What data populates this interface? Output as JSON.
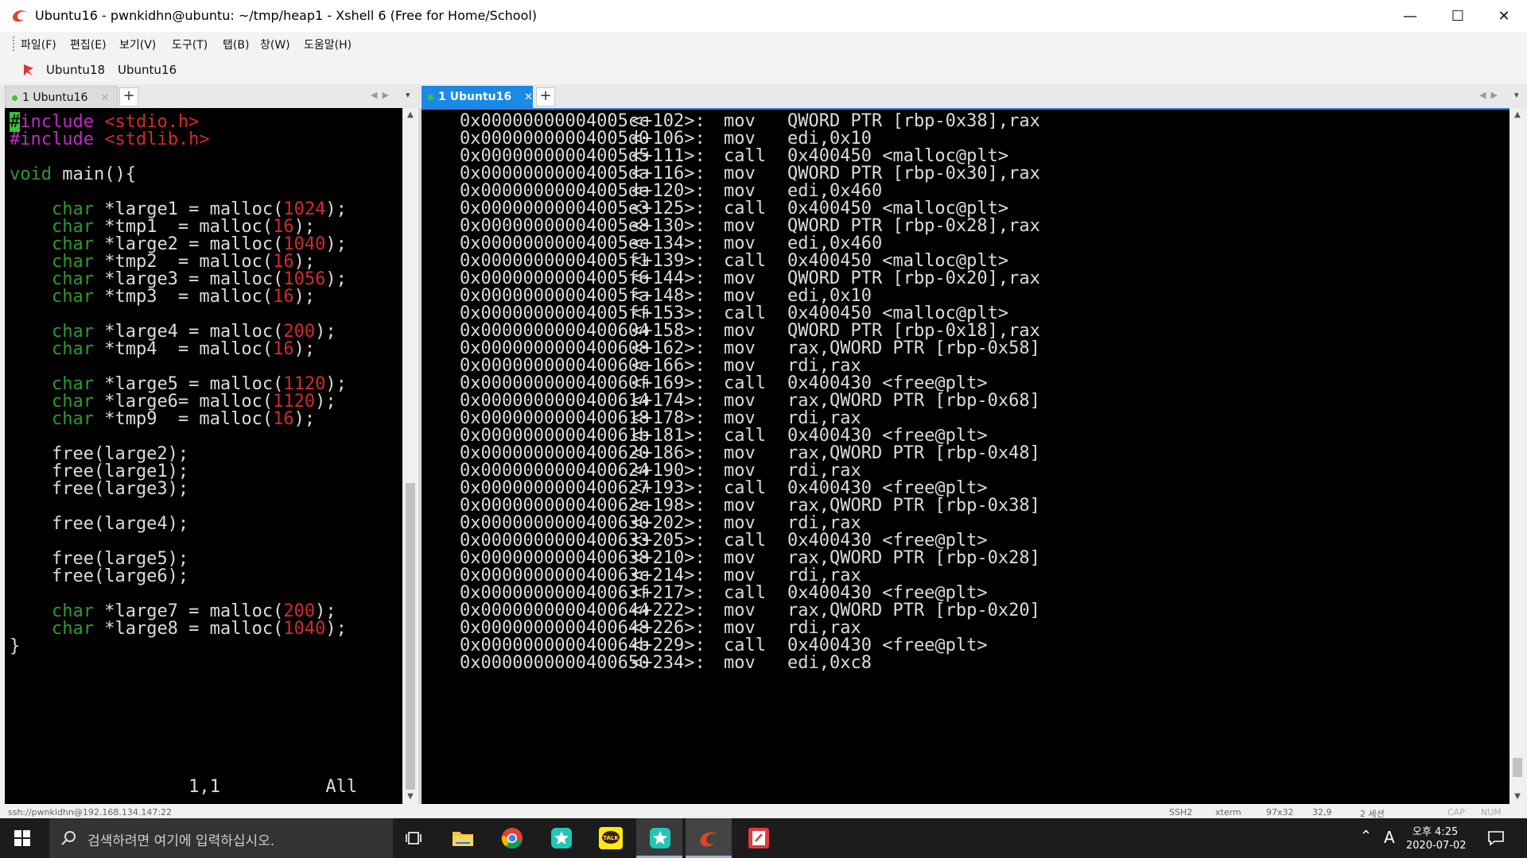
{
  "window": {
    "title": "Ubuntu16 - pwnkidhn@ubuntu: ~/tmp/heap1 - Xshell 6 (Free for Home/School)",
    "minimize": "—",
    "maximize": "☐",
    "close": "✕"
  },
  "menu": [
    "파일(F)",
    "편집(E)",
    "보기(V)",
    "도구(T)",
    "탭(B)",
    "창(W)",
    "도움말(H)"
  ],
  "sessions": [
    "Ubuntu18",
    "Ubuntu16"
  ],
  "left_tab": {
    "label": "1 Ubuntu16",
    "close": "✕",
    "add": "+"
  },
  "right_tab": {
    "label": "1 Ubuntu16",
    "close": "✕",
    "add": "+"
  },
  "tab_nav": {
    "prev": "◀",
    "next": "▶",
    "menu": "▾"
  },
  "editor": {
    "lines": [
      [
        {
          "t": "#",
          "c": "cursor"
        },
        {
          "t": "include ",
          "c": "pp"
        },
        {
          "t": "<stdio.h>",
          "c": "str"
        }
      ],
      [
        {
          "t": "#include ",
          "c": "pp"
        },
        {
          "t": "<stdlib.h>",
          "c": "str"
        }
      ],
      [],
      [
        {
          "t": "void",
          "c": "kw"
        },
        {
          "t": " main(){",
          "c": ""
        }
      ],
      [],
      [
        {
          "t": "    ",
          "c": ""
        },
        {
          "t": "char",
          "c": "kw"
        },
        {
          "t": " *large1 = malloc(",
          "c": ""
        },
        {
          "t": "1024",
          "c": "num"
        },
        {
          "t": ");",
          "c": ""
        }
      ],
      [
        {
          "t": "    ",
          "c": ""
        },
        {
          "t": "char",
          "c": "kw"
        },
        {
          "t": " *tmp1  = malloc(",
          "c": ""
        },
        {
          "t": "16",
          "c": "num"
        },
        {
          "t": ");",
          "c": ""
        }
      ],
      [
        {
          "t": "    ",
          "c": ""
        },
        {
          "t": "char",
          "c": "kw"
        },
        {
          "t": " *large2 = malloc(",
          "c": ""
        },
        {
          "t": "1040",
          "c": "num"
        },
        {
          "t": ");",
          "c": ""
        }
      ],
      [
        {
          "t": "    ",
          "c": ""
        },
        {
          "t": "char",
          "c": "kw"
        },
        {
          "t": " *tmp2  = malloc(",
          "c": ""
        },
        {
          "t": "16",
          "c": "num"
        },
        {
          "t": ");",
          "c": ""
        }
      ],
      [
        {
          "t": "    ",
          "c": ""
        },
        {
          "t": "char",
          "c": "kw"
        },
        {
          "t": " *large3 = malloc(",
          "c": ""
        },
        {
          "t": "1056",
          "c": "num"
        },
        {
          "t": ");",
          "c": ""
        }
      ],
      [
        {
          "t": "    ",
          "c": ""
        },
        {
          "t": "char",
          "c": "kw"
        },
        {
          "t": " *tmp3  = malloc(",
          "c": ""
        },
        {
          "t": "16",
          "c": "num"
        },
        {
          "t": ");",
          "c": ""
        }
      ],
      [],
      [
        {
          "t": "    ",
          "c": ""
        },
        {
          "t": "char",
          "c": "kw"
        },
        {
          "t": " *large4 = malloc(",
          "c": ""
        },
        {
          "t": "200",
          "c": "num"
        },
        {
          "t": ");",
          "c": ""
        }
      ],
      [
        {
          "t": "    ",
          "c": ""
        },
        {
          "t": "char",
          "c": "kw"
        },
        {
          "t": " *tmp4  = malloc(",
          "c": ""
        },
        {
          "t": "16",
          "c": "num"
        },
        {
          "t": ");",
          "c": ""
        }
      ],
      [],
      [
        {
          "t": "    ",
          "c": ""
        },
        {
          "t": "char",
          "c": "kw"
        },
        {
          "t": " *large5 = malloc(",
          "c": ""
        },
        {
          "t": "1120",
          "c": "num"
        },
        {
          "t": ");",
          "c": ""
        }
      ],
      [
        {
          "t": "    ",
          "c": ""
        },
        {
          "t": "char",
          "c": "kw"
        },
        {
          "t": " *large6= malloc(",
          "c": ""
        },
        {
          "t": "1120",
          "c": "num"
        },
        {
          "t": ");",
          "c": ""
        }
      ],
      [
        {
          "t": "    ",
          "c": ""
        },
        {
          "t": "char",
          "c": "kw"
        },
        {
          "t": " *tmp9  = malloc(",
          "c": ""
        },
        {
          "t": "16",
          "c": "num"
        },
        {
          "t": ");",
          "c": ""
        }
      ],
      [],
      [
        {
          "t": "    free(large2);",
          "c": ""
        }
      ],
      [
        {
          "t": "    free(large1);",
          "c": ""
        }
      ],
      [
        {
          "t": "    free(large3);",
          "c": ""
        }
      ],
      [],
      [
        {
          "t": "    free(large4);",
          "c": ""
        }
      ],
      [],
      [
        {
          "t": "    free(large5);",
          "c": ""
        }
      ],
      [
        {
          "t": "    free(large6);",
          "c": ""
        }
      ],
      [],
      [
        {
          "t": "    ",
          "c": ""
        },
        {
          "t": "char",
          "c": "kw"
        },
        {
          "t": " *large7 = malloc(",
          "c": ""
        },
        {
          "t": "200",
          "c": "num"
        },
        {
          "t": ");",
          "c": ""
        }
      ],
      [
        {
          "t": "    ",
          "c": ""
        },
        {
          "t": "char",
          "c": "kw"
        },
        {
          "t": " *large8 = malloc(",
          "c": ""
        },
        {
          "t": "1040",
          "c": "num"
        },
        {
          "t": ");",
          "c": ""
        }
      ],
      [
        {
          "t": "}",
          "c": ""
        }
      ]
    ],
    "status": "                 1,1          All"
  },
  "disasm": [
    [
      "0x00000000004005cc",
      "<+102>:",
      "mov",
      "QWORD PTR [rbp-0x38],rax"
    ],
    [
      "0x00000000004005d0",
      "<+106>:",
      "mov",
      "edi,0x10"
    ],
    [
      "0x00000000004005d5",
      "<+111>:",
      "call",
      "0x400450 <malloc@plt>"
    ],
    [
      "0x00000000004005da",
      "<+116>:",
      "mov",
      "QWORD PTR [rbp-0x30],rax"
    ],
    [
      "0x00000000004005de",
      "<+120>:",
      "mov",
      "edi,0x460"
    ],
    [
      "0x00000000004005e3",
      "<+125>:",
      "call",
      "0x400450 <malloc@plt>"
    ],
    [
      "0x00000000004005e8",
      "<+130>:",
      "mov",
      "QWORD PTR [rbp-0x28],rax"
    ],
    [
      "0x00000000004005ec",
      "<+134>:",
      "mov",
      "edi,0x460"
    ],
    [
      "0x00000000004005f1",
      "<+139>:",
      "call",
      "0x400450 <malloc@plt>"
    ],
    [
      "0x00000000004005f6",
      "<+144>:",
      "mov",
      "QWORD PTR [rbp-0x20],rax"
    ],
    [
      "0x00000000004005fa",
      "<+148>:",
      "mov",
      "edi,0x10"
    ],
    [
      "0x00000000004005ff",
      "<+153>:",
      "call",
      "0x400450 <malloc@plt>"
    ],
    [
      "0x0000000000400604",
      "<+158>:",
      "mov",
      "QWORD PTR [rbp-0x18],rax"
    ],
    [
      "0x0000000000400608",
      "<+162>:",
      "mov",
      "rax,QWORD PTR [rbp-0x58]"
    ],
    [
      "0x000000000040060c",
      "<+166>:",
      "mov",
      "rdi,rax"
    ],
    [
      "0x000000000040060f",
      "<+169>:",
      "call",
      "0x400430 <free@plt>"
    ],
    [
      "0x0000000000400614",
      "<+174>:",
      "mov",
      "rax,QWORD PTR [rbp-0x68]"
    ],
    [
      "0x0000000000400618",
      "<+178>:",
      "mov",
      "rdi,rax"
    ],
    [
      "0x000000000040061b",
      "<+181>:",
      "call",
      "0x400430 <free@plt>"
    ],
    [
      "0x0000000000400620",
      "<+186>:",
      "mov",
      "rax,QWORD PTR [rbp-0x48]"
    ],
    [
      "0x0000000000400624",
      "<+190>:",
      "mov",
      "rdi,rax"
    ],
    [
      "0x0000000000400627",
      "<+193>:",
      "call",
      "0x400430 <free@plt>"
    ],
    [
      "0x000000000040062c",
      "<+198>:",
      "mov",
      "rax,QWORD PTR [rbp-0x38]"
    ],
    [
      "0x0000000000400630",
      "<+202>:",
      "mov",
      "rdi,rax"
    ],
    [
      "0x0000000000400633",
      "<+205>:",
      "call",
      "0x400430 <free@plt>"
    ],
    [
      "0x0000000000400638",
      "<+210>:",
      "mov",
      "rax,QWORD PTR [rbp-0x28]"
    ],
    [
      "0x000000000040063c",
      "<+214>:",
      "mov",
      "rdi,rax"
    ],
    [
      "0x000000000040063f",
      "<+217>:",
      "call",
      "0x400430 <free@plt>"
    ],
    [
      "0x0000000000400644",
      "<+222>:",
      "mov",
      "rax,QWORD PTR [rbp-0x20]"
    ],
    [
      "0x0000000000400648",
      "<+226>:",
      "mov",
      "rdi,rax"
    ],
    [
      "0x000000000040064b",
      "<+229>:",
      "call",
      "0x400430 <free@plt>"
    ],
    [
      "0x0000000000400650",
      "<+234>:",
      "mov",
      "edi,0xc8"
    ]
  ],
  "statusbar": {
    "connection": "ssh://pwnkidhn@192.168.134.147:22",
    "protocol": "SSH2",
    "term": "xterm",
    "size": "97x32",
    "pos": "32,9",
    "sessions": "2 세션",
    "cap": "CAP",
    "num": "NUM"
  },
  "taskbar": {
    "search_placeholder": "검색하려면 여기에 입력하십시오.",
    "apps": [
      "task-view",
      "file-explorer",
      "chrome",
      "app-star-teal",
      "kakaotalk",
      "app-star-orange",
      "xshell",
      "xftp"
    ],
    "ime_label": "A",
    "time": "오후 4:25",
    "date": "2020-07-02"
  },
  "colors": {
    "terminal_bg": "#000000",
    "terminal_fg": "#dcdcdc",
    "keyword": "#2e9a2e",
    "preprocessor": "#c22ac2",
    "literal": "#d42a2a",
    "accent": "#1a8ae6"
  }
}
